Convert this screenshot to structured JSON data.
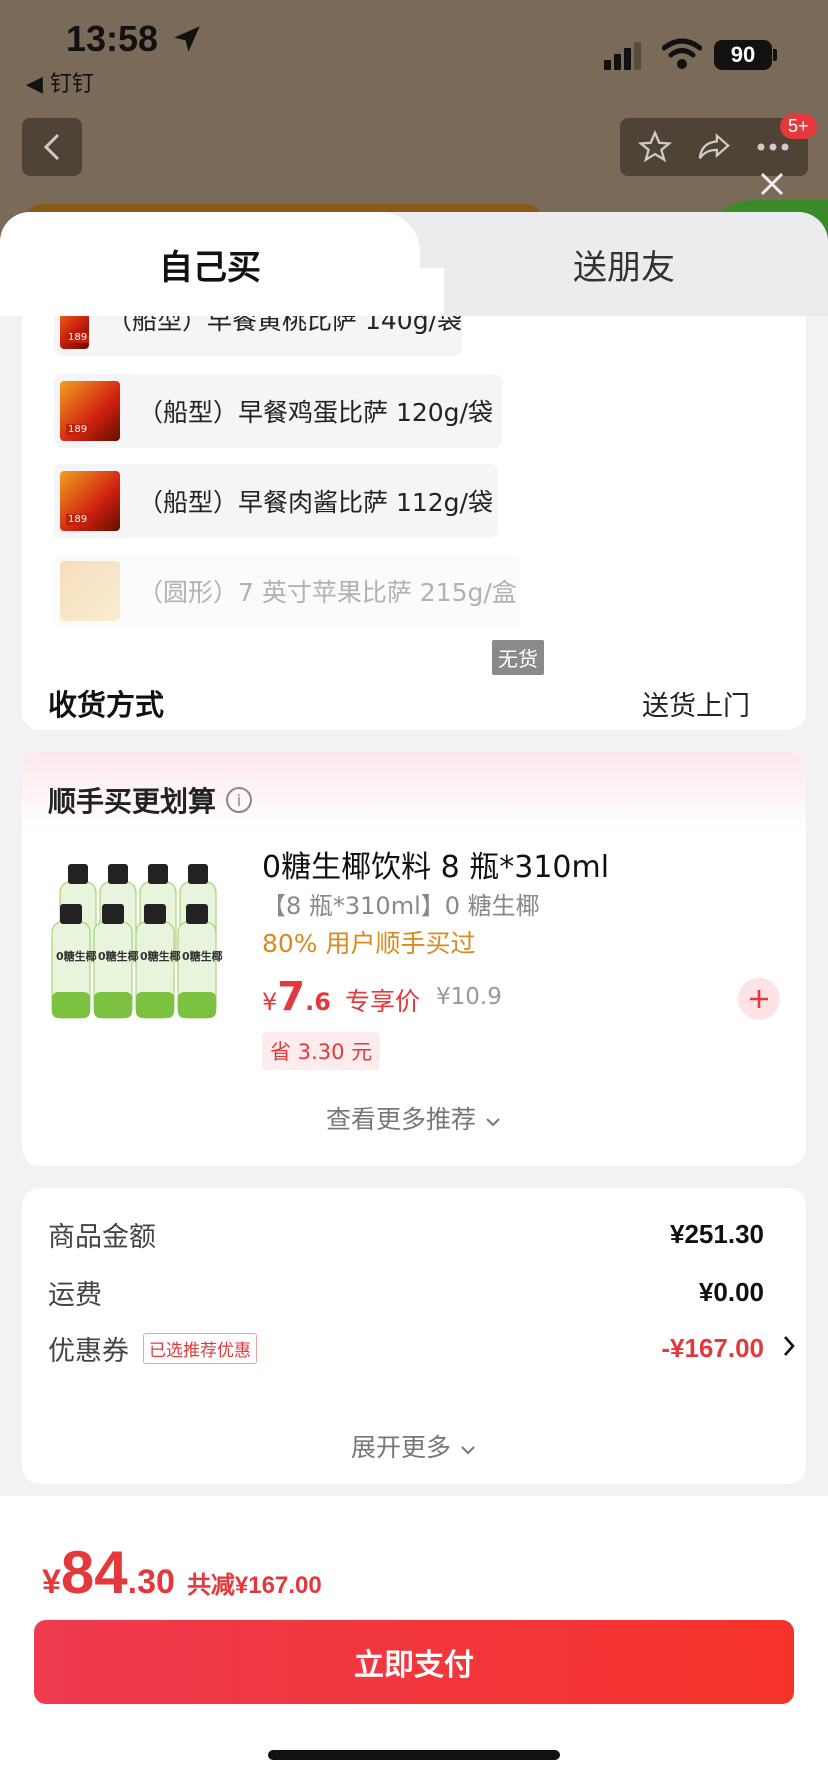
{
  "status": {
    "time": "13:58",
    "back_app": "◀ 钉钉",
    "battery": "90"
  },
  "nav": {
    "badge": "5+"
  },
  "tabs": [
    {
      "label": "自己买"
    },
    {
      "label": "送朋友"
    }
  ],
  "products": [
    {
      "name": "（船型）早餐黄桃比萨 140g/袋"
    },
    {
      "name": "（船型）早餐鸡蛋比萨 120g/袋"
    },
    {
      "name": "（船型）早餐肉酱比萨 112g/袋"
    },
    {
      "name": "（圆形）7 英寸苹果比萨 215g/盒"
    }
  ],
  "no_stock_label": "无货",
  "shipping": {
    "label": "收货方式",
    "value": "送货上门"
  },
  "reco": {
    "title": "顺手买更划算",
    "image_text": "0糖生椰",
    "name": "0糖生椰饮料 8 瓶*310ml",
    "sub": "【8 瓶*310ml】0 糖生椰",
    "bought": "80% 用户顺手买过",
    "price_currency": "¥",
    "price_int": "7",
    "price_dec": ".6",
    "price_tag": "专享价",
    "orig_price": "¥10.9",
    "save": "省 3.30 元",
    "more": "查看更多推荐"
  },
  "summary": {
    "goods_label": "商品金额",
    "goods_value": "¥251.30",
    "freight_label": "运费",
    "freight_value": "¥0.00",
    "coupon_label": "优惠券",
    "coupon_tag": "已选推荐优惠",
    "coupon_value": "-¥167.00",
    "expand": "展开更多"
  },
  "footer": {
    "currency": "¥",
    "total_int": "84",
    "total_dec": ".30",
    "reduce": "共减¥167.00",
    "pay_label": "立即支付"
  },
  "colors": {
    "accent": "#e4393c",
    "orange": "#d88a20",
    "pay_gradient_start": "#ef3b4f",
    "pay_gradient_end": "#f5322a"
  }
}
